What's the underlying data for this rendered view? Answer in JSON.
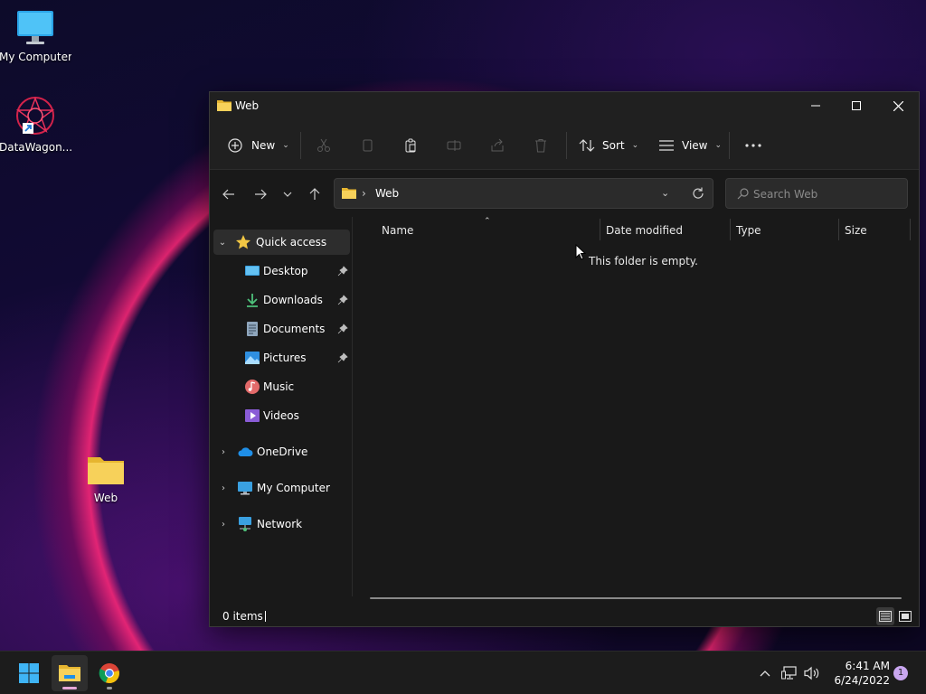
{
  "desktop": {
    "icons": [
      {
        "label": "My Computer",
        "icon": "monitor-icon"
      },
      {
        "label": "DataWagon...",
        "icon": "datawagon-logo-icon"
      },
      {
        "label": "Web",
        "icon": "folder-icon"
      }
    ]
  },
  "window": {
    "title": "Web",
    "controls": {
      "minimize": "minimize-icon",
      "maximize": "maximize-icon",
      "close": "close-icon"
    }
  },
  "toolbar": {
    "new_label": "New",
    "sort_label": "Sort",
    "view_label": "View",
    "icons": [
      "cut-icon",
      "copy-icon",
      "paste-icon",
      "rename-icon",
      "share-icon",
      "delete-icon",
      "more-icon"
    ]
  },
  "address": {
    "path": "Web",
    "separator": "›",
    "search_placeholder": "Search Web"
  },
  "sidebar": {
    "quick_access": "Quick access",
    "items": [
      {
        "label": "Desktop",
        "pinned": true
      },
      {
        "label": "Downloads",
        "pinned": true
      },
      {
        "label": "Documents",
        "pinned": true
      },
      {
        "label": "Pictures",
        "pinned": true
      },
      {
        "label": "Music",
        "pinned": false
      },
      {
        "label": "Videos",
        "pinned": false
      }
    ],
    "onedrive": "OneDrive",
    "my_computer": "My Computer",
    "network": "Network"
  },
  "content": {
    "columns": [
      "Name",
      "Date modified",
      "Type",
      "Size"
    ],
    "empty_message": "This folder is empty."
  },
  "status": {
    "items": "0 items"
  },
  "taskbar": {
    "time": "6:41 AM",
    "date": "6/24/2022",
    "notifications": "1"
  },
  "colors": {
    "folder": "#f2c744",
    "accent": "#60cdff",
    "window_bg": "#191919",
    "taskbar_bg": "#1c1c1c"
  }
}
